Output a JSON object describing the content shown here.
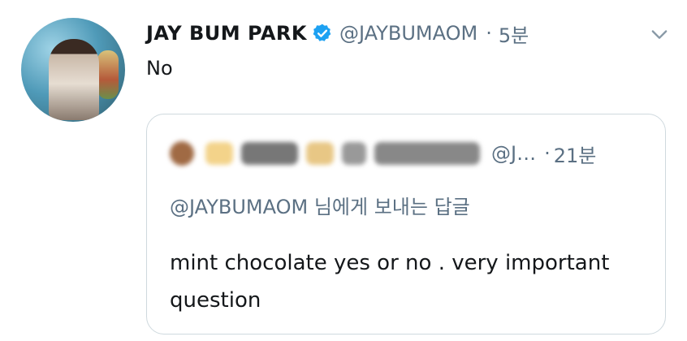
{
  "tweet": {
    "display_name": "JAY BUM PARK",
    "handle": "@JAYBUMAOM",
    "separator": "·",
    "time": "5분",
    "text": "No",
    "verified": true,
    "icons": {
      "verified": "verified-badge-icon",
      "more": "chevron-down-icon"
    },
    "colors": {
      "verified": "#1da1f2",
      "secondary_text": "#5b7083",
      "border": "#cfd9de"
    }
  },
  "quoted_tweet": {
    "handle": "@J…",
    "separator": "·",
    "time": "21분",
    "reply_to": "@JAYBUMAOM 님에게 보내는 답글",
    "text": "mint chocolate yes or no . very important question"
  }
}
